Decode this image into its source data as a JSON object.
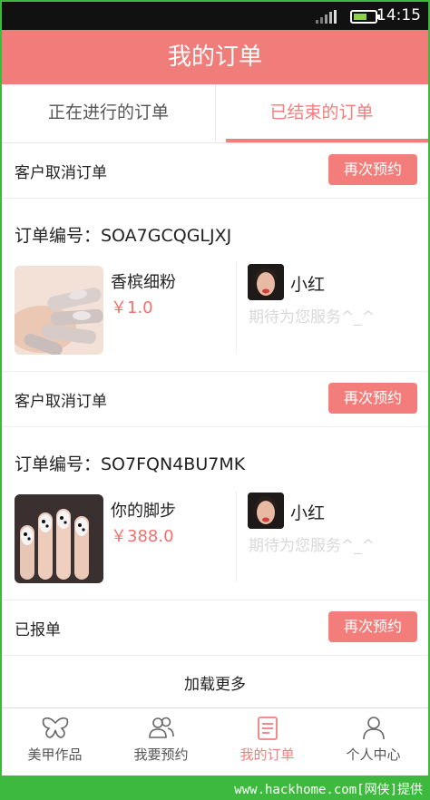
{
  "status_bar": {
    "time": "14:15"
  },
  "header": {
    "title": "我的订单"
  },
  "tabs": [
    {
      "label": "正在进行的订单",
      "active": false
    },
    {
      "label": "已结束的订单",
      "active": true
    }
  ],
  "orders": [
    {
      "status": "客户取消订单",
      "rebook_label": "再次预约",
      "order_no": "订单编号：SOA7GCQGLJXJ",
      "product_name": "香槟细粉",
      "price": "￥1.0",
      "artist_name": "小红",
      "greeting": "期待为您服务^_^"
    },
    {
      "status": "客户取消订单",
      "rebook_label": "再次预约",
      "order_no": "订单编号：SO7FQN4BU7MK",
      "product_name": "你的脚步",
      "price": "￥388.0",
      "artist_name": "小红",
      "greeting": "期待为您服务^_^"
    },
    {
      "status": "已报单",
      "rebook_label": "再次预约"
    }
  ],
  "load_more": "加载更多",
  "bottom_nav": [
    {
      "label": "美甲作品",
      "icon": "butterfly-icon",
      "active": false
    },
    {
      "label": "我要预约",
      "icon": "users-icon",
      "active": false
    },
    {
      "label": "我的订单",
      "icon": "order-list-icon",
      "active": true
    },
    {
      "label": "个人中心",
      "icon": "person-icon",
      "active": false
    }
  ],
  "watermark": "www.hackhome.com[网侠]提供",
  "colors": {
    "accent": "#f17d7b",
    "price": "#f2706d",
    "inactive_text": "#555555"
  }
}
